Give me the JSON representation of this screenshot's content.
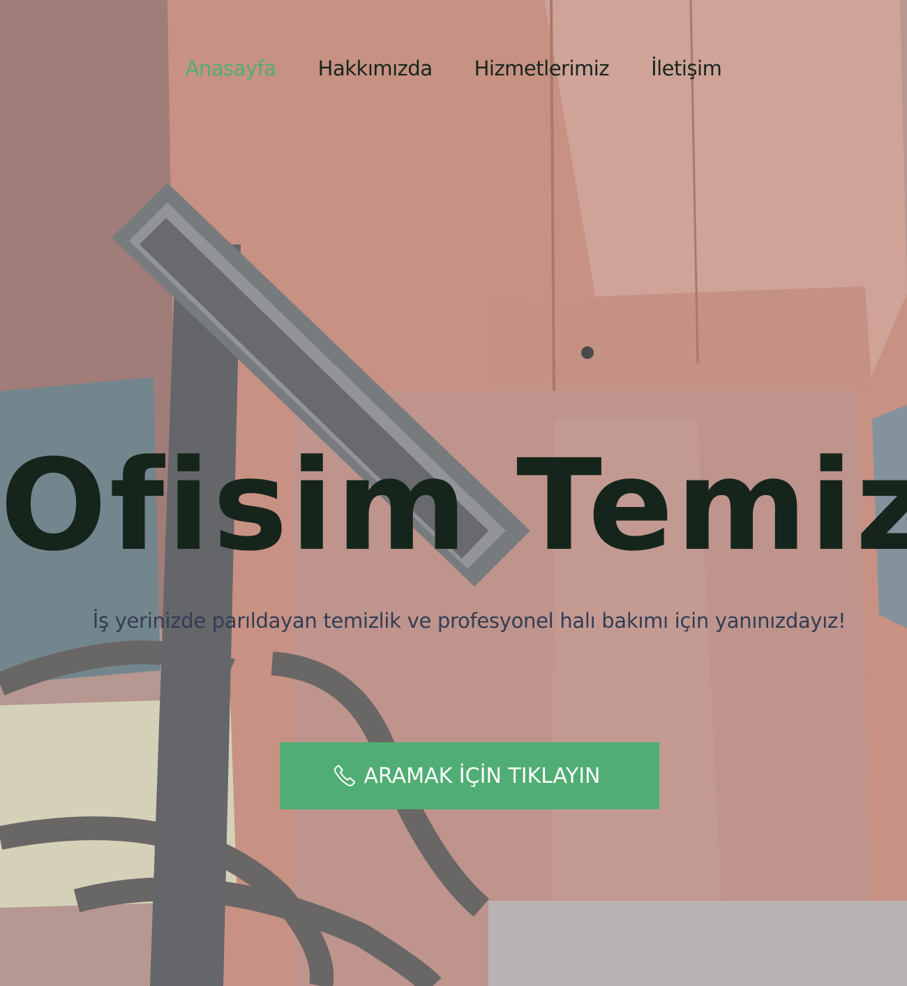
{
  "nav": {
    "items": [
      {
        "label": "Anasayfa",
        "active": true
      },
      {
        "label": "Hakkımızda",
        "active": false
      },
      {
        "label": "Hizmetlerimiz",
        "active": false
      },
      {
        "label": "İletişim",
        "active": false
      }
    ]
  },
  "hero": {
    "title": "Ofisim Temiz",
    "subtitle": "İş yerinizde parıldayan temizlik ve profesyonel halı bakımı için yanınızdayız!",
    "cta": {
      "label": "ARAMAK İÇİN TIKLAYIN",
      "icon": "phone-icon"
    }
  },
  "colors": {
    "accent": "#50ad73",
    "active_link": "#4fae72",
    "title": "#16251c",
    "subtitle": "#323c54"
  }
}
